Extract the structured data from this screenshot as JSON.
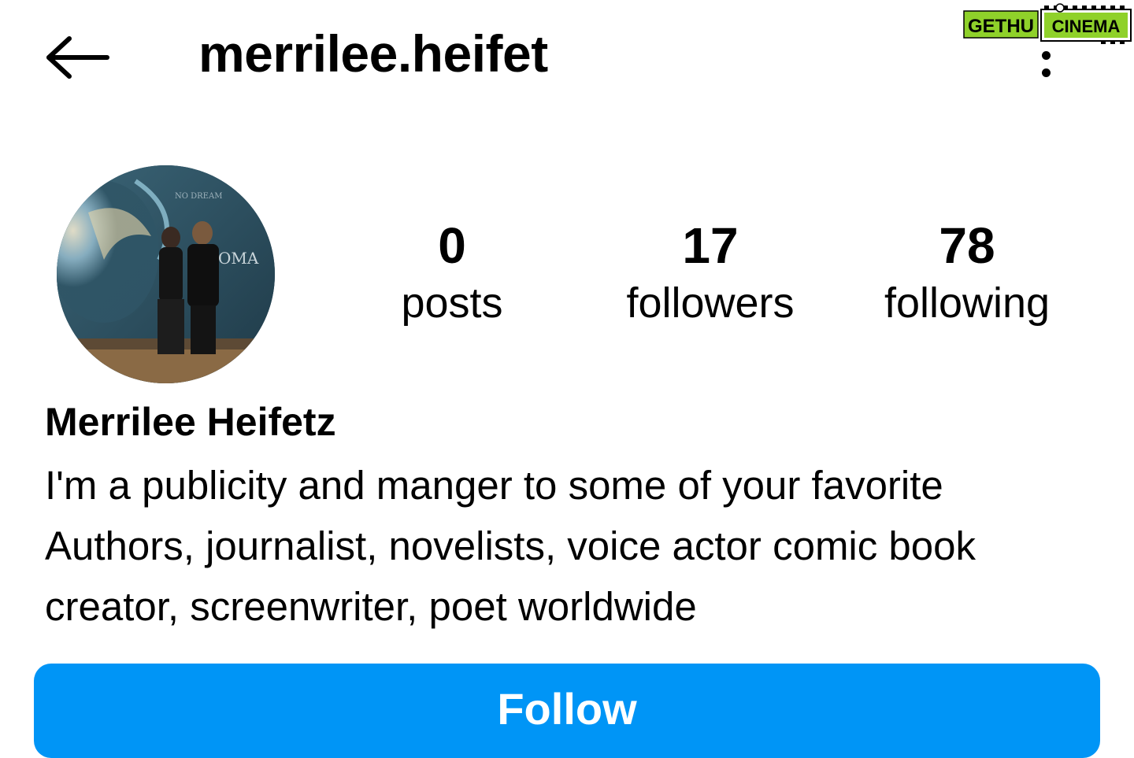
{
  "header": {
    "username": "merrilee.heifet",
    "back_icon": "arrow-left-icon",
    "more_icon": "more-vertical-icon"
  },
  "watermark": {
    "left_text": "GETHU",
    "right_text": "CINEMA",
    "colors": {
      "left": "#8fd12a",
      "right": "#8fd12a",
      "text": "#000000"
    }
  },
  "profile": {
    "avatar_icon": "profile-photo",
    "stats": [
      {
        "count": "0",
        "label": "posts"
      },
      {
        "count": "17",
        "label": "followers"
      },
      {
        "count": "78",
        "label": "following"
      }
    ],
    "display_name": "Merrilee Heifetz",
    "bio_lines": [
      "I'm a publicity and manger to some of your favorite",
      "Authors, journalist, novelists, voice actor comic book",
      "creator, screenwriter, poet worldwide"
    ]
  },
  "actions": {
    "follow_label": "Follow"
  },
  "colors": {
    "accent": "#0095f6",
    "text": "#000000",
    "background": "#ffffff"
  }
}
